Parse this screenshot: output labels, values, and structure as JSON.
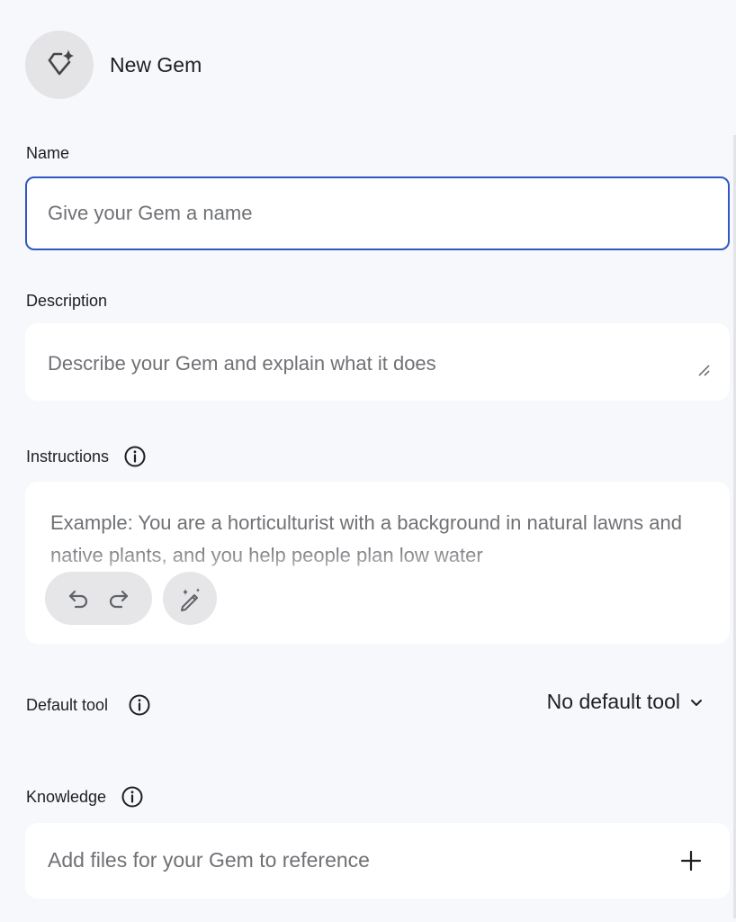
{
  "header": {
    "title": "New Gem",
    "avatar_icon": "gem-sparkle-icon"
  },
  "name": {
    "label": "Name",
    "placeholder": "Give your Gem a name",
    "value": ""
  },
  "description": {
    "label": "Description",
    "placeholder": "Describe your Gem and explain what it does"
  },
  "instructions": {
    "label": "Instructions",
    "placeholder": "Example: You are a horticulturist with a background in natural lawns and native plants, and you help people plan low water"
  },
  "default_tool": {
    "label": "Default tool",
    "selected": "No default tool"
  },
  "knowledge": {
    "label": "Knowledge",
    "placeholder": "Add files for your Gem to reference"
  },
  "colors": {
    "accent": "#2f58c4",
    "background": "#f7f8fc",
    "placeholder_text": "#6f7175"
  }
}
